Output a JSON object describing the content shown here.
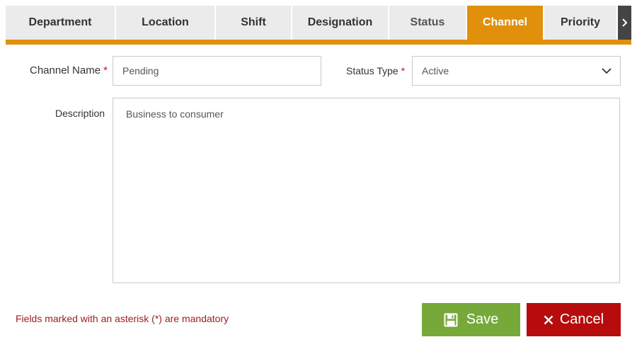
{
  "tabs": [
    {
      "label": "Department"
    },
    {
      "label": "Location"
    },
    {
      "label": "Shift"
    },
    {
      "label": "Designation"
    },
    {
      "label": "Status"
    },
    {
      "label": "Channel"
    },
    {
      "label": "Priority"
    }
  ],
  "active_tab": "Channel",
  "form": {
    "channel_name_label": "Channel Name",
    "channel_name_value": "Pending",
    "status_type_label": "Status Type",
    "status_type_value": "Active",
    "description_label": "Description",
    "description_value": "Business to consumer",
    "required_marker": "*",
    "mandatory_note": "Fields marked with an asterisk (*) are mandatory"
  },
  "buttons": {
    "save_label": "Save",
    "cancel_label": "Cancel"
  },
  "colors": {
    "accent": "#e0900b",
    "save": "#77a93a",
    "cancel": "#b60c0c",
    "required": "#c0161b"
  },
  "icons": {
    "tab_scroll": "chevron-right-icon",
    "select": "chevron-down-icon",
    "save": "save-icon",
    "cancel": "close-icon"
  }
}
